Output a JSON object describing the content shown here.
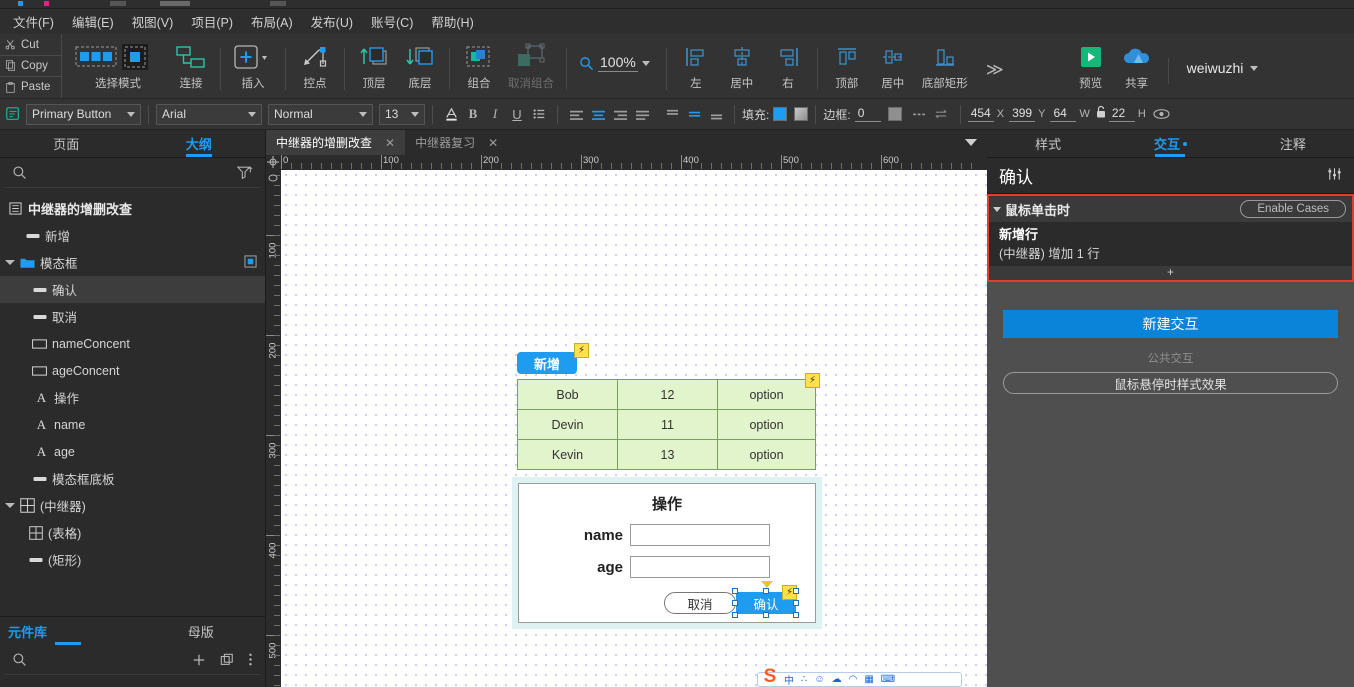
{
  "menubar": {
    "items": [
      {
        "label": "文件(F)"
      },
      {
        "label": "编辑(E)"
      },
      {
        "label": "视图(V)"
      },
      {
        "label": "项目(P)"
      },
      {
        "label": "布局(A)"
      },
      {
        "label": "发布(U)"
      },
      {
        "label": "账号(C)"
      },
      {
        "label": "帮助(H)"
      }
    ]
  },
  "clipboard": {
    "cut": "Cut",
    "copy": "Copy",
    "paste": "Paste"
  },
  "toolbar": {
    "select_mode": "选择模式",
    "connect": "连接",
    "insert": "插入",
    "control_point": "控点",
    "bring_front": "顶层",
    "send_back": "底层",
    "group": "组合",
    "ungroup": "取消组合",
    "zoom_value": "100%",
    "align_left": "左",
    "align_center": "居中",
    "align_right": "右",
    "align_top": "顶部",
    "align_middle": "居中",
    "align_bottom": "底部矩形",
    "more": "≫",
    "preview": "预览",
    "share": "共享",
    "username": "weiwuzhi"
  },
  "formatbar": {
    "widget_style": "Primary Button",
    "font_family": "Arial",
    "font_weight": "Normal",
    "font_size": "13",
    "fill_label": "填充:",
    "border_label": "边框:",
    "border_value": "0",
    "x_value": "454",
    "x_label": "X",
    "y_value": "399",
    "y_label": "Y",
    "w_value": "64",
    "w_label": "W",
    "h_value": "22",
    "h_label": "H",
    "accent_color": "#1e9cf0"
  },
  "left_panel": {
    "tabs": [
      {
        "label": "页面",
        "active": false
      },
      {
        "label": "大纲",
        "active": true
      }
    ],
    "tree": [
      {
        "label": "中继器的增删改查",
        "indent": 0,
        "icon": "page-icon",
        "arrow": false,
        "selected": false,
        "root": true
      },
      {
        "label": "新增",
        "indent": 1,
        "icon": "rect-button-icon",
        "arrow": false,
        "selected": false,
        "root": false
      },
      {
        "label": "模态框",
        "indent": 0,
        "icon": "folder-icon",
        "arrow": true,
        "selected": false,
        "root": false,
        "badge": true
      },
      {
        "label": "确认",
        "indent": 2,
        "icon": "rect-button-icon",
        "arrow": false,
        "selected": true,
        "root": false
      },
      {
        "label": "取消",
        "indent": 2,
        "icon": "rect-button-icon",
        "arrow": false,
        "selected": false,
        "root": false
      },
      {
        "label": "nameConcent",
        "indent": 2,
        "icon": "rectangle-icon",
        "arrow": false,
        "selected": false,
        "root": false
      },
      {
        "label": "ageConcent",
        "indent": 2,
        "icon": "rectangle-icon",
        "arrow": false,
        "selected": false,
        "root": false
      },
      {
        "label": "操作",
        "indent": 2,
        "icon": "text-icon",
        "arrow": false,
        "selected": false,
        "root": false
      },
      {
        "label": "name",
        "indent": 2,
        "icon": "text-icon",
        "arrow": false,
        "selected": false,
        "root": false
      },
      {
        "label": "age",
        "indent": 2,
        "icon": "text-icon",
        "arrow": false,
        "selected": false,
        "root": false
      },
      {
        "label": "模态框底板",
        "indent": 2,
        "icon": "rect-button-icon",
        "arrow": false,
        "selected": false,
        "root": false
      },
      {
        "label": "(中继器)",
        "indent": 0,
        "icon": "table-icon",
        "arrow": true,
        "selected": false,
        "root": false
      },
      {
        "label": "(表格)",
        "indent": 1,
        "icon": "table-icon",
        "arrow": false,
        "selected": false,
        "root": false
      },
      {
        "label": "(矩形)",
        "indent": 1,
        "icon": "rect-button-icon",
        "arrow": false,
        "selected": false,
        "root": false
      }
    ],
    "library_tabs": [
      {
        "label": "元件库",
        "active": true
      },
      {
        "label": "母版",
        "active": false
      }
    ]
  },
  "canvas": {
    "tabs": [
      {
        "label": "中继器的增删改查",
        "active": true
      },
      {
        "label": "中继器复习",
        "active": false
      }
    ],
    "ruler_h_labels": [
      "0",
      "100",
      "200",
      "300",
      "400",
      "500",
      "600"
    ],
    "ruler_v_labels": [
      "100",
      "200",
      "300",
      "400",
      "500"
    ],
    "add_button_label": "新增",
    "table": {
      "rows": [
        [
          "Bob",
          "12",
          "option"
        ],
        [
          "Devin",
          "11",
          "option"
        ],
        [
          "Kevin",
          "13",
          "option"
        ]
      ]
    },
    "modal": {
      "title": "操作",
      "name_label": "name",
      "name_value": "",
      "age_label": "age",
      "age_value": "",
      "cancel_label": "取消",
      "ok_label": "确认"
    }
  },
  "right_panel": {
    "tabs": [
      {
        "label": "样式",
        "active": false,
        "dot": false
      },
      {
        "label": "交互",
        "active": true,
        "dot": true
      },
      {
        "label": "注释",
        "active": false,
        "dot": false
      }
    ],
    "widget_name": "确认",
    "event": {
      "name": "鼠标单击时",
      "enable_cases_label": "Enable Cases",
      "case_name": "新增行",
      "action_text": "(中继器) 增加 1 行",
      "add_symbol": "+",
      "highlight_color": "#e23c2e"
    },
    "new_interaction_label": "新建交互",
    "public_interaction_label": "公共交互",
    "hover_style_label": "鼠标悬停时样式效果"
  },
  "ime": {
    "logo": "S",
    "icons": [
      "中",
      "∴",
      "☺",
      "☁",
      "◠",
      "▦",
      "⌨"
    ]
  }
}
